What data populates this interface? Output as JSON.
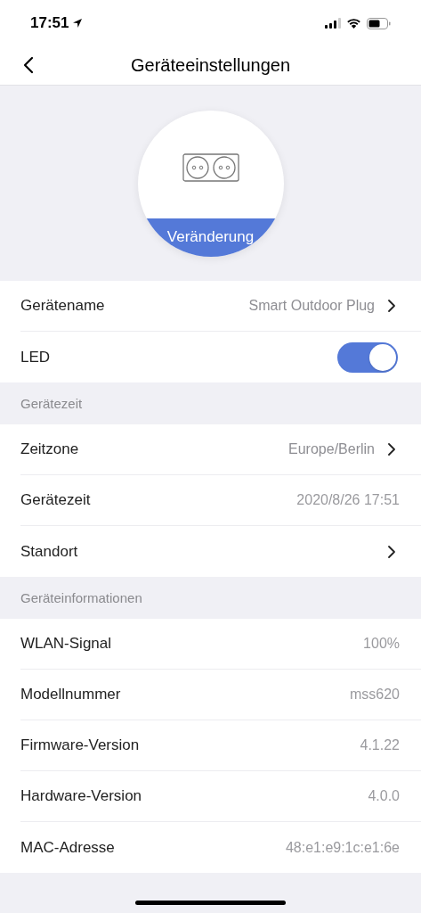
{
  "status_bar": {
    "time": "17:51"
  },
  "nav": {
    "title": "Geräteeinstellungen"
  },
  "device": {
    "button": "Veränderung"
  },
  "sections": [
    {
      "rows": [
        {
          "kind": "link",
          "label": "Gerätename",
          "value": "Smart Outdoor Plug"
        },
        {
          "kind": "toggle",
          "label": "LED",
          "on": true
        }
      ]
    },
    {
      "header": "Gerätezeit",
      "rows": [
        {
          "kind": "link",
          "label": "Zeitzone",
          "value": "Europe/Berlin"
        },
        {
          "kind": "info",
          "label": "Gerätezeit",
          "value": "2020/8/26 17:51"
        },
        {
          "kind": "link",
          "label": "Standort"
        }
      ]
    },
    {
      "header": "Geräteinformationen",
      "rows": [
        {
          "kind": "info",
          "label": "WLAN-Signal",
          "value": "100%"
        },
        {
          "kind": "info",
          "label": "Modellnummer",
          "value": "mss620"
        },
        {
          "kind": "info",
          "label": "Firmware-Version",
          "value": "4.1.22"
        },
        {
          "kind": "info",
          "label": "Hardware-Version",
          "value": "4.0.0"
        },
        {
          "kind": "info",
          "label": "MAC-Adresse",
          "value": "48:e1:e9:1c:e1:6e"
        }
      ]
    }
  ]
}
